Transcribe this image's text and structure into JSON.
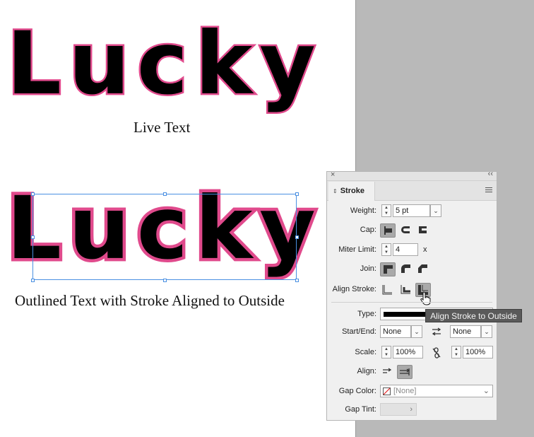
{
  "canvas": {
    "live_word": "Lucky",
    "outlined_word": "Lucky",
    "live_caption": "Live Text",
    "outlined_caption": "Outlined Text with Stroke Aligned to Outside",
    "fill_color": "#000000",
    "stroke_color": "#e04a8c"
  },
  "panel": {
    "tab_label": "Stroke",
    "weight": {
      "label": "Weight:",
      "value": "5 pt"
    },
    "cap": {
      "label": "Cap:"
    },
    "miter": {
      "label": "Miter Limit:",
      "value": "4",
      "suffix": "x"
    },
    "join": {
      "label": "Join:"
    },
    "align_stroke": {
      "label": "Align Stroke:"
    },
    "type": {
      "label": "Type:"
    },
    "start_end": {
      "label": "Start/End:",
      "start": "None",
      "end": "None"
    },
    "scale": {
      "label": "Scale:",
      "start": "100%",
      "end": "100%"
    },
    "align": {
      "label": "Align:"
    },
    "gap_color": {
      "label": "Gap Color:",
      "value": "[None]"
    },
    "gap_tint": {
      "label": "Gap Tint:"
    }
  },
  "tooltip": "Align Stroke to Outside"
}
